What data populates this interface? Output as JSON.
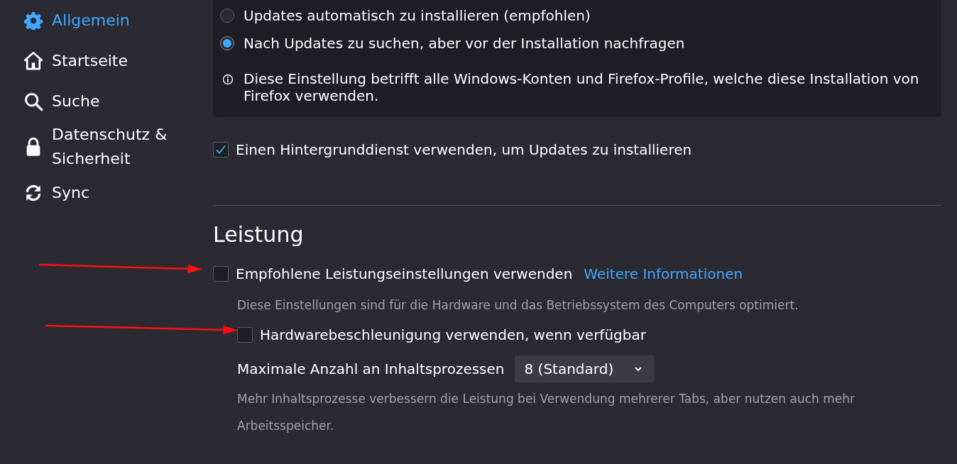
{
  "sidebar": {
    "items": [
      {
        "label": "Allgemein",
        "selected": true
      },
      {
        "label": "Startseite",
        "selected": false
      },
      {
        "label": "Suche",
        "selected": false
      },
      {
        "label": "Datenschutz & Sicherheit",
        "selected": false
      },
      {
        "label": "Sync",
        "selected": false
      }
    ]
  },
  "updates": {
    "radios": [
      {
        "label": "Updates automatisch zu installieren (empfohlen)",
        "selected": false
      },
      {
        "label": "Nach Updates zu suchen, aber vor der Installation nachfragen",
        "selected": true
      }
    ],
    "note": "Diese Einstellung betrifft alle Windows-Konten und Firefox-Profile, welche diese Installation von Firefox verwenden."
  },
  "background_service": {
    "label": "Einen Hintergrunddienst verwenden, um Updates zu installieren",
    "checked": true
  },
  "performance": {
    "title": "Leistung",
    "items": [
      {
        "kind": "checkbox",
        "label": "Empfohlene Leistungseinstellungen verwenden",
        "link": "Weitere Informationen",
        "checked": false,
        "arrow": true
      },
      {
        "kind": "hint",
        "text": "Diese Einstellungen sind für die Hardware und das Betriebssystem des Computers optimiert."
      },
      {
        "kind": "checkbox",
        "label": "Hardwarebeschleunigung verwenden, wenn verfügbar",
        "checked": false,
        "arrow": true,
        "indented": true
      },
      {
        "kind": "select",
        "label": "Maximale Anzahl an Inhaltsprozessen",
        "value": "8 (Standard)"
      },
      {
        "kind": "hint",
        "text": "Mehr Inhaltsprozesse verbessern die Leistung bei Verwendung mehrerer Tabs, aber nutzen auch mehr Arbeitsspeicher.",
        "indented": true
      }
    ]
  }
}
